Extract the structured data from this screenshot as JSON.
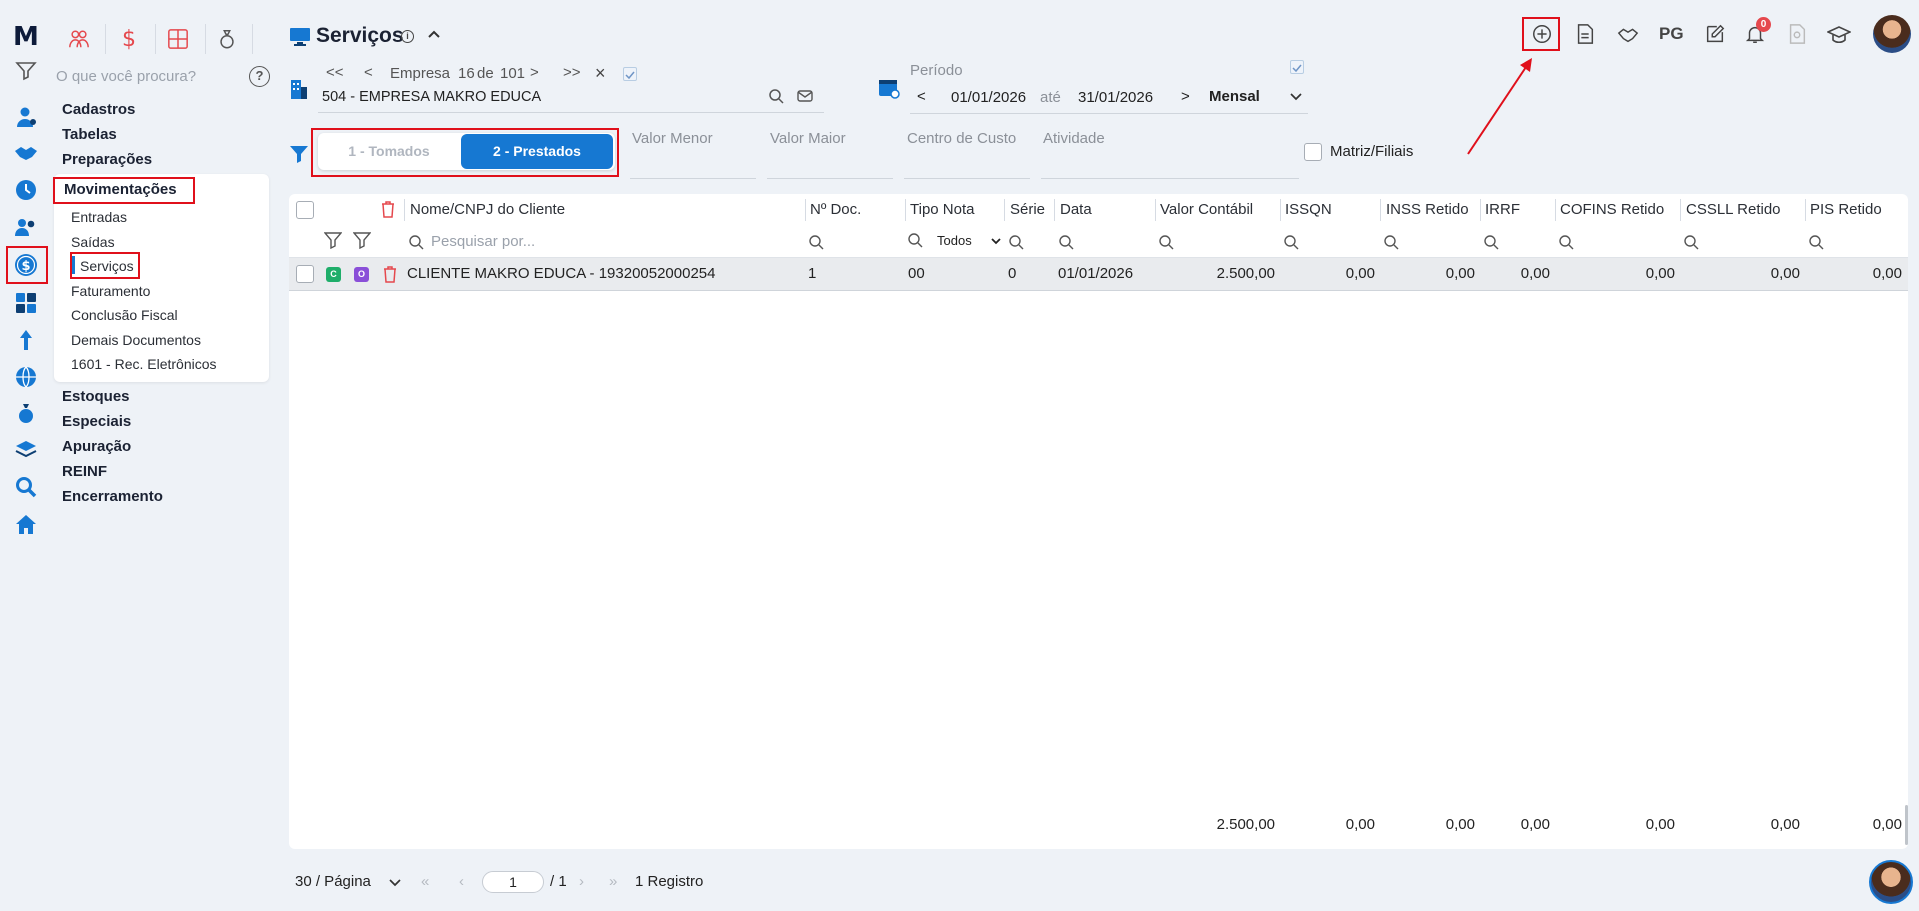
{
  "app": {
    "logo_text": "M"
  },
  "search": {
    "placeholder": "O que você procura?",
    "help": "?"
  },
  "menu": {
    "top": [
      "Cadastros",
      "Tabelas",
      "Preparações",
      "Movimentações"
    ],
    "sub": [
      "Entradas",
      "Saídas",
      "Serviços",
      "Faturamento",
      "Conclusão Fiscal",
      "Demais Documentos",
      "1601 - Rec. Eletrônicos"
    ],
    "bottom": [
      "Estoques",
      "Especiais",
      "Apuração",
      "REINF",
      "Encerramento"
    ]
  },
  "header": {
    "title": "Serviços",
    "pg_label": "PG",
    "notif_count": "0"
  },
  "empresa": {
    "label": "Empresa",
    "current": "16",
    "of": "de",
    "total": "101",
    "name": "504 - EMPRESA MAKRO EDUCA"
  },
  "periodo": {
    "label": "Período",
    "from": "01/01/2026",
    "sep": "até",
    "to": "31/01/2026",
    "mode": "Mensal"
  },
  "toggle": {
    "off": "1 - Tomados",
    "on": "2 - Prestados"
  },
  "filters": {
    "valor_menor": "Valor Menor",
    "valor_maior": "Valor Maior",
    "centro_custo": "Centro de Custo",
    "atividade": "Atividade",
    "matriz": "Matriz/Filiais"
  },
  "table": {
    "columns": [
      "Nome/CNPJ do Cliente",
      "Nº Doc.",
      "Tipo Nota",
      "Série",
      "Data",
      "Valor Contábil",
      "ISSQN",
      "INSS Retido",
      "IRRF",
      "COFINS Retido",
      "CSSLL Retido",
      "PIS Retido"
    ],
    "search_placeholder": "Pesquisar por...",
    "tipo_filter": "Todos",
    "badge_c": "C",
    "badge_o": "O",
    "rows": [
      {
        "cliente": "CLIENTE MAKRO EDUCA - 19320052000254",
        "doc": "1",
        "tipo": "00",
        "serie": "0",
        "data": "01/01/2026",
        "valor": "2.500,00",
        "issqn": "0,00",
        "inss": "0,00",
        "irrf": "0,00",
        "cofins": "0,00",
        "csll": "0,00",
        "pis": "0,00"
      }
    ],
    "totals": {
      "valor": "2.500,00",
      "issqn": "0,00",
      "inss": "0,00",
      "irrf": "0,00",
      "cofins": "0,00",
      "csll": "0,00",
      "pis": "0,00"
    }
  },
  "pager": {
    "per_page": "30 / Página",
    "page": "1",
    "of": "/ 1",
    "records": "1 Registro"
  },
  "colors": {
    "accent": "#1678d2",
    "highlight": "#e0101b",
    "brand_dark": "#0d1b3a"
  }
}
